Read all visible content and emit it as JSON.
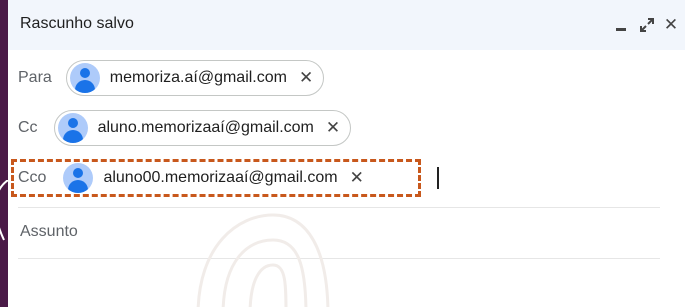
{
  "window": {
    "title": "Rascunho salvo"
  },
  "recipients": {
    "to": {
      "label": "Para",
      "email": "memoriza.aí@gmail.com"
    },
    "cc": {
      "label": "Cc",
      "email": "aluno.memorizaaí@gmail.com"
    },
    "bcc": {
      "label": "Cco",
      "email": "aluno00.memorizaaí@gmail.com"
    }
  },
  "subject": {
    "placeholder": "Assunto"
  },
  "icons": {
    "minimize": "minimize-icon",
    "expand": "expand-icon",
    "close": "close-icon",
    "chip_remove": "close-icon",
    "avatar": "person-avatar-icon"
  },
  "colors": {
    "header_bg": "#f2f6fc",
    "page_bg": "#4a1a47",
    "highlight": "#c8581c",
    "avatar_bg": "#aecbfa",
    "avatar_fg": "#1a73e8"
  }
}
